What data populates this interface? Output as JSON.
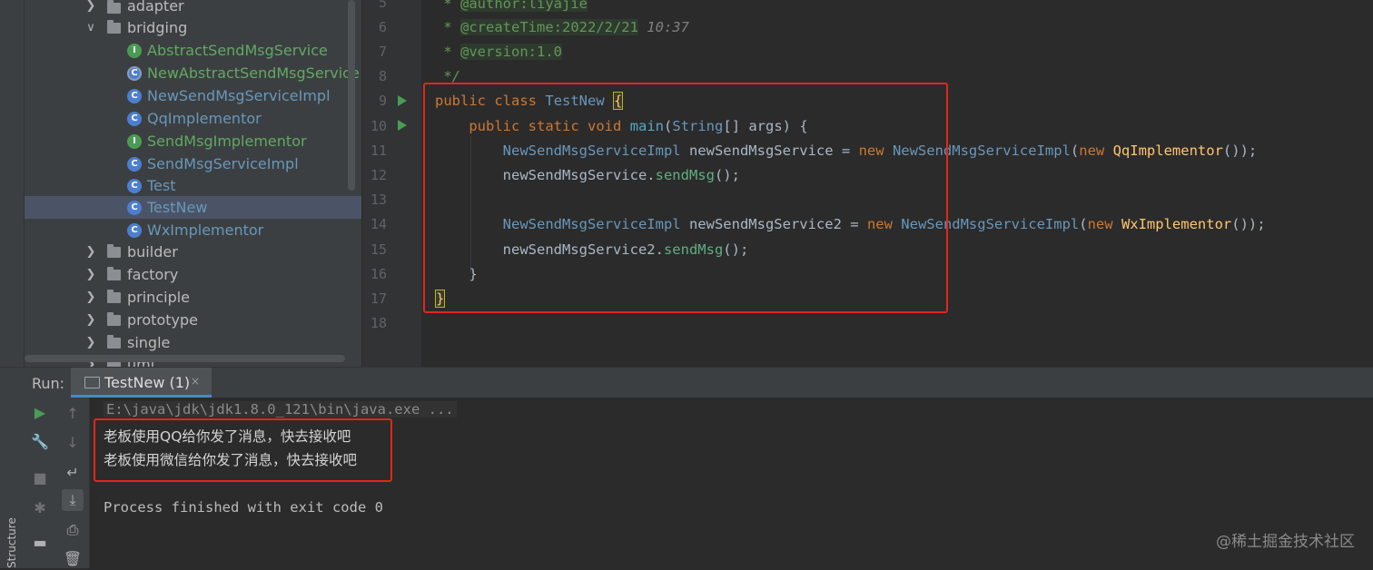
{
  "project_tree": {
    "items": [
      {
        "label": "adapter",
        "kind": "folder",
        "state": "collapsed"
      },
      {
        "label": "bridging",
        "kind": "folder",
        "state": "expanded"
      },
      {
        "label": "AbstractSendMsgService",
        "kind": "interface"
      },
      {
        "label": "NewAbstractSendMsgService",
        "kind": "abstract-class"
      },
      {
        "label": "NewSendMsgServiceImpl",
        "kind": "class"
      },
      {
        "label": "QqImplementor",
        "kind": "class"
      },
      {
        "label": "SendMsgImplementor",
        "kind": "interface"
      },
      {
        "label": "SendMsgServiceImpl",
        "kind": "class"
      },
      {
        "label": "Test",
        "kind": "class"
      },
      {
        "label": "TestNew",
        "kind": "class",
        "selected": true
      },
      {
        "label": "WxImplementor",
        "kind": "class"
      },
      {
        "label": "builder",
        "kind": "folder",
        "state": "collapsed"
      },
      {
        "label": "factory",
        "kind": "folder",
        "state": "collapsed"
      },
      {
        "label": "principle",
        "kind": "folder",
        "state": "collapsed"
      },
      {
        "label": "prototype",
        "kind": "folder",
        "state": "collapsed"
      },
      {
        "label": "single",
        "kind": "folder",
        "state": "collapsed"
      },
      {
        "label": "uml",
        "kind": "folder",
        "state": "collapsed"
      }
    ],
    "icon_letters": {
      "class": "C",
      "interface": "I",
      "abstract-class": "C"
    }
  },
  "editor": {
    "line_numbers": [
      "5",
      "6",
      "7",
      "8",
      "9",
      "10",
      "11",
      "12",
      "13",
      "14",
      "15",
      "16",
      "17",
      "18"
    ],
    "lines": {
      "l5": {
        "prefix": " * ",
        "tag": "@author:liyajie"
      },
      "l6": {
        "prefix": " * ",
        "tag": "@createTime:2022/2/21",
        "rest": " 10:37"
      },
      "l7": {
        "prefix": " * ",
        "tag": "@version:1.0"
      },
      "l8": {
        "text": " */"
      },
      "l9": {
        "kw1": "public",
        "kw2": "class",
        "name": "TestNew",
        "brace": "{"
      },
      "l10": {
        "kw1": "public",
        "kw2": "static",
        "kw3": "void",
        "fn": "main",
        "sig_type": "String",
        "sig_rest": "[] args) {",
        "open": "("
      },
      "l11": {
        "type": "NewSendMsgServiceImpl",
        "var": " newSendMsgService = ",
        "new1": "new",
        "ctor": "NewSendMsgServiceImpl",
        "paren": "(",
        "new2": "new",
        "arg": "QqImplementor",
        "end": "());"
      },
      "l12": {
        "obj": "newSendMsgService.",
        "call": "sendMsg",
        "end": "();"
      },
      "l14": {
        "type": "NewSendMsgServiceImpl",
        "var": " newSendMsgService2 = ",
        "new1": "new",
        "ctor": "NewSendMsgServiceImpl",
        "paren": "(",
        "new2": "new",
        "arg": "WxImplementor",
        "end": "());"
      },
      "l15": {
        "obj": "newSendMsgService2.",
        "call": "sendMsg",
        "end": "();"
      },
      "l16": {
        "text": "}"
      },
      "l17": {
        "text": "}"
      }
    }
  },
  "run_panel": {
    "label": "Run:",
    "tab_label": "TestNew (1)",
    "tab_close": "×",
    "console": {
      "command": "E:\\java\\jdk\\jdk1.8.0_121\\bin\\java.exe ...",
      "output": [
        "老板使用QQ给你发了消息，快去接收吧",
        "老板使用微信给你发了消息，快去接收吧"
      ],
      "exit": "Process finished with exit code 0"
    }
  },
  "side_tabs": {
    "structure": "Structure"
  },
  "watermark": "@稀土掘金技术社区",
  "colors": {
    "highlight_box": "#e3261b",
    "selection": "#4b5466",
    "run_green": "#499c54"
  }
}
